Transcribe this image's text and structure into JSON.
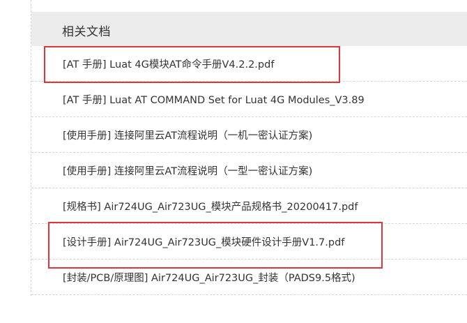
{
  "section": {
    "title": "相关文档"
  },
  "documents": [
    {
      "label": "[AT 手册] Luat 4G模块AT命令手册V4.2.2.pdf"
    },
    {
      "label": "[AT 手册] Luat AT COMMAND Set for Luat 4G Modules_V3.89"
    },
    {
      "label": "[使用手册] 连接阿里云AT流程说明（一机一密认证方案)"
    },
    {
      "label": "[使用手册] 连接阿里云AT流程说明（一型一密认证方案)"
    },
    {
      "label": "[规格书] Air724UG_Air723UG_模块产品规格书_20200417.pdf"
    },
    {
      "label": "[设计手册] Air724UG_Air723UG_模块硬件设计手册V1.7.pdf"
    },
    {
      "label": "[封装/PCB/原理图] Air724UG_Air723UG_封装（PADS9.5格式)"
    }
  ],
  "colors": {
    "highlight": "#e0343b",
    "header_bg": "#ececec",
    "text": "#333333"
  }
}
